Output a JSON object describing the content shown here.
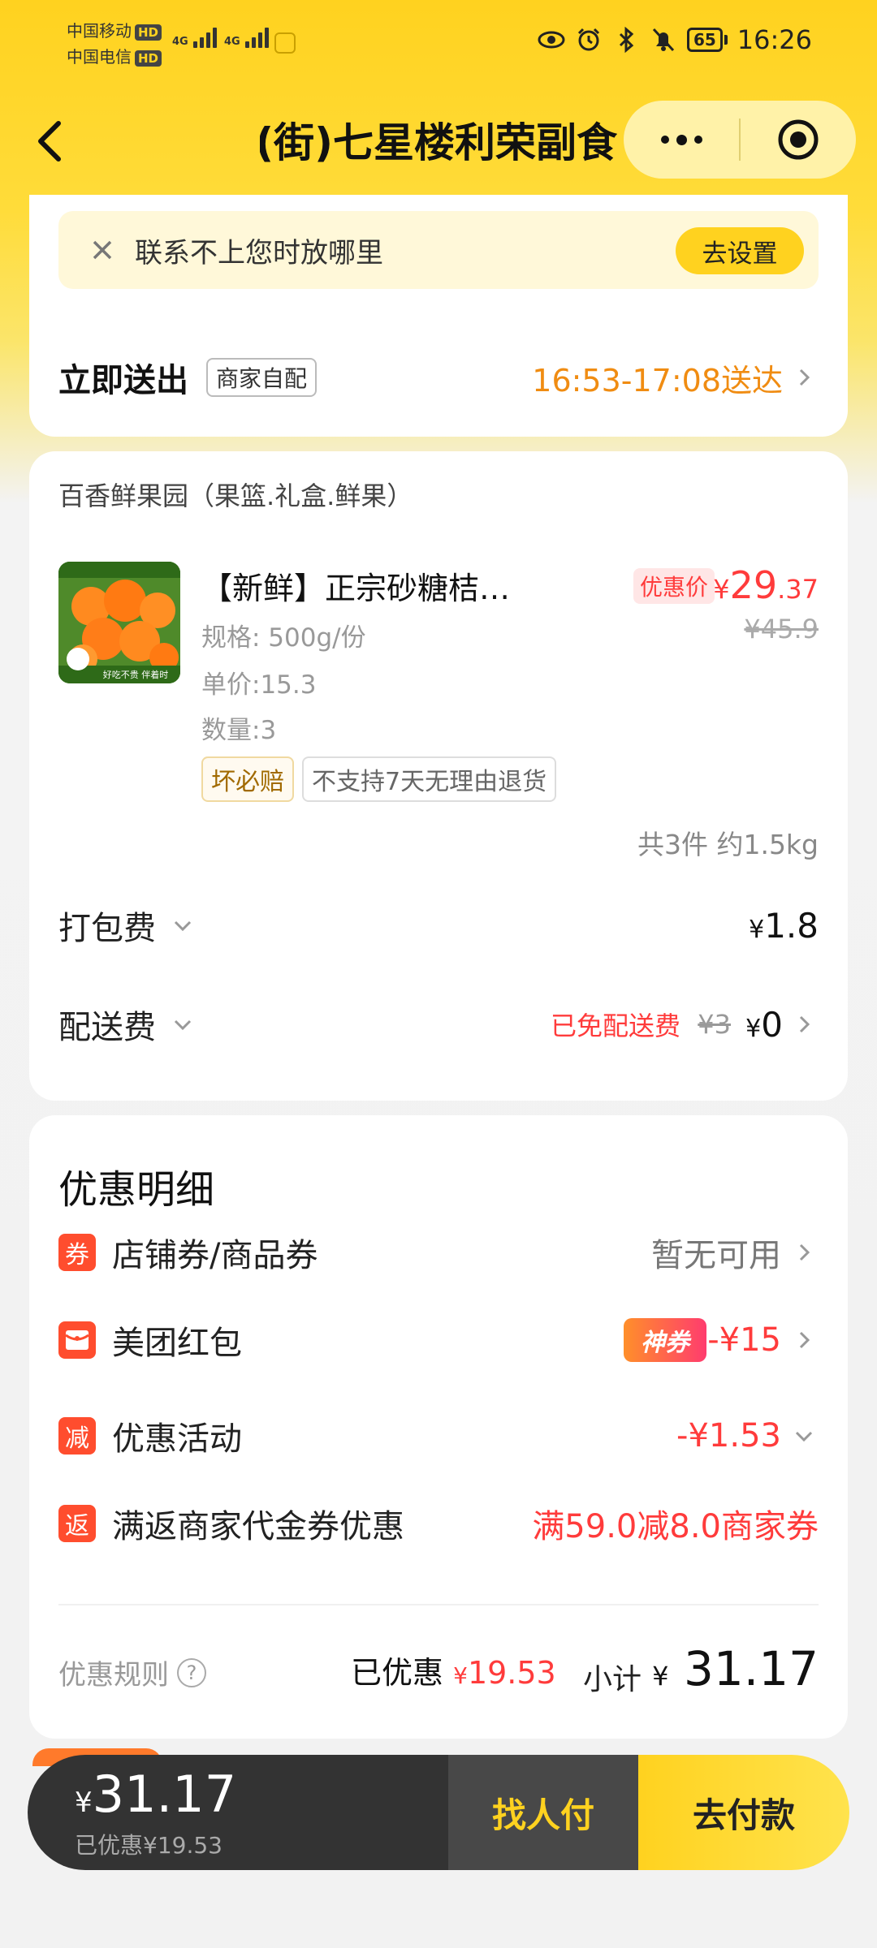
{
  "status_bar": {
    "carrier1": "中国移动",
    "carrier2": "中国电信",
    "hd": "HD",
    "net1": "4G",
    "net2": "4G",
    "battery": "65",
    "time": "16:26"
  },
  "nav": {
    "title": "(街)七星楼利荣副食",
    "back_icon": "back-arrow-icon",
    "more_icon": "more-dots-icon",
    "close_icon": "target-close-icon"
  },
  "notice": {
    "text": "联系不上您时放哪里",
    "button": "去设置"
  },
  "delivery": {
    "title": "立即送出",
    "tag": "商家自配",
    "time": "16:53-17:08送达"
  },
  "shop": {
    "name": "百香鲜果园（果篮.礼盒.鲜果）"
  },
  "product": {
    "name": "【新鲜】正宗砂糖桔…",
    "promo_tag": "优惠价",
    "price_currency": "¥",
    "price_int": "29",
    "price_dec": ".37",
    "original_price": "¥45.9",
    "spec": "规格: 500g/份",
    "unit_price": "单价:15.3",
    "quantity": "数量:3",
    "badge1": "坏必赔",
    "badge2": "不支持7天无理由退货",
    "summary": "共3件 约1.5kg",
    "image_label": "好吃不贵 伴着时"
  },
  "fees": {
    "packing_label": "打包费",
    "packing_currency": "¥",
    "packing_amount": "1.8",
    "delivery_label": "配送费",
    "delivery_free_note": "已免配送费",
    "delivery_orig": "¥3",
    "delivery_currency": "¥",
    "delivery_amount": "0"
  },
  "discounts": {
    "title": "优惠明细",
    "rows": [
      {
        "icon": "券",
        "label": "店铺券/商品券",
        "value": "暂无可用"
      },
      {
        "icon": "红包",
        "label": "美团红包",
        "badge": "神券",
        "value": "-¥15"
      },
      {
        "icon": "减",
        "label": "优惠活动",
        "value": "-¥1.53"
      },
      {
        "icon": "返",
        "label": "满返商家代金券优惠",
        "value": "满59.0减8.0商家券"
      }
    ],
    "rules_label": "优惠规则",
    "saved_label": "已优惠",
    "saved_currency": "¥",
    "saved_amount": "19.53",
    "subtotal_label": "小计",
    "subtotal_currency": "¥",
    "subtotal_amount": "31.17"
  },
  "pay_bar": {
    "currency": "¥",
    "total": "31.17",
    "saved": "已优惠¥19.53",
    "pay_other": "找人付",
    "pay_now": "去付款"
  },
  "colors": {
    "brand_yellow": "#ffd21f",
    "price_red": "#ff3b3b",
    "time_orange": "#f08c12"
  }
}
